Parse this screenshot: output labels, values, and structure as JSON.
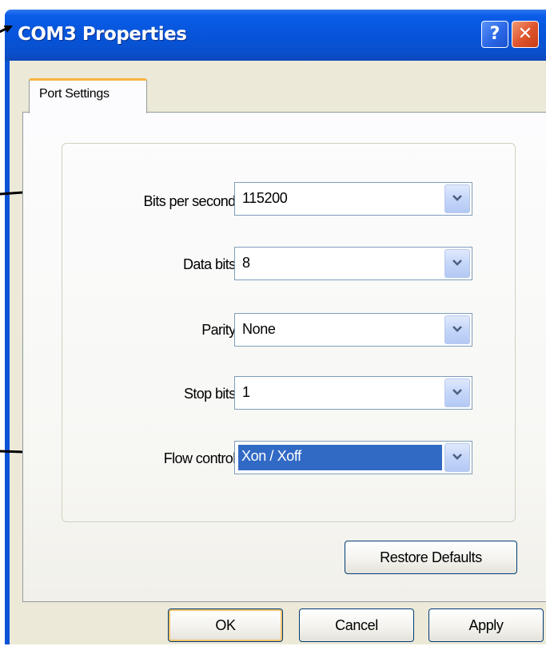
{
  "window": {
    "title": "COM3 Properties",
    "help_glyph": "?",
    "close_glyph": "✕"
  },
  "tabs": [
    {
      "label": "Port Settings",
      "active": true
    }
  ],
  "fields": {
    "bits_per_second": {
      "label": "Bits per second:",
      "value": "115200"
    },
    "data_bits": {
      "label": "Data bits:",
      "value": "8"
    },
    "parity": {
      "label": "Parity:",
      "value": "None"
    },
    "stop_bits": {
      "label": "Stop bits:",
      "value": "1"
    },
    "flow_control": {
      "label": "Flow control:",
      "value": "Xon / Xoff",
      "selected": true
    }
  },
  "buttons": {
    "restore_defaults": "Restore Defaults",
    "ok": "OK",
    "cancel": "Cancel",
    "apply": "Apply"
  },
  "icons": {
    "help": "help-icon",
    "close": "close-icon",
    "dropdown": "chevron-down-icon",
    "annotation": "arrow-icon"
  },
  "colors": {
    "titlebar": "#0654d8",
    "selection": "#316ac5",
    "dialog_face": "#ece9d8",
    "close_button": "#e0562f",
    "tab_highlight": "#f8b340"
  }
}
